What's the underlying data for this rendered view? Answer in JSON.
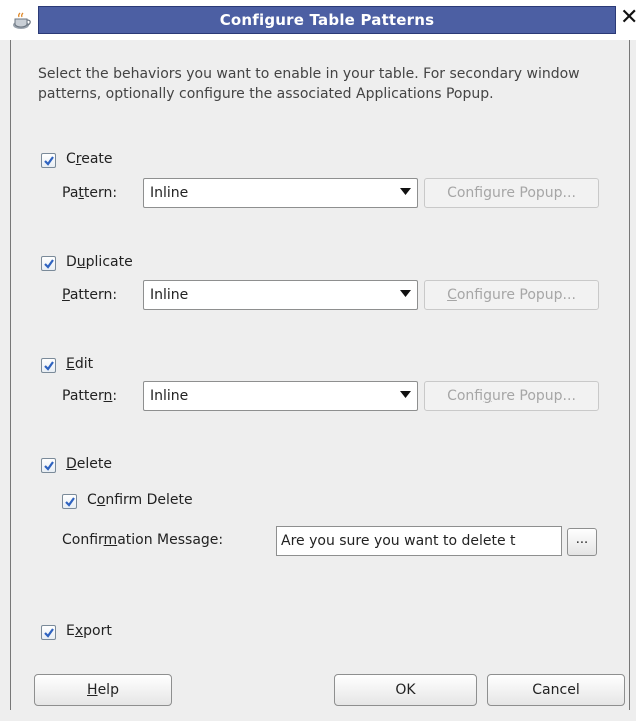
{
  "window": {
    "title": "Configure Table Patterns",
    "icon": "coffee-cup-icon",
    "close_glyph": "✕"
  },
  "intro_text": "Select the behaviors you want to enable in your table.  For secondary window patterns, optionally configure the associated Applications Popup.",
  "sections": {
    "create": {
      "checked": true,
      "label_pre": "C",
      "label_mn": "r",
      "label_post": "eate",
      "pattern_label_pre": "Pa",
      "pattern_label_mn": "t",
      "pattern_label_post": "tern:",
      "pattern_value": "Inline",
      "popup_pre": "Conf",
      "popup_mn": "i",
      "popup_post": "gure Popup..."
    },
    "duplicate": {
      "checked": true,
      "label_pre": "D",
      "label_mn": "u",
      "label_post": "plicate",
      "pattern_label_pre": "",
      "pattern_label_mn": "P",
      "pattern_label_post": "attern:",
      "pattern_value": "Inline",
      "popup_pre": "",
      "popup_mn": "C",
      "popup_post": "onfigure Popup..."
    },
    "edit": {
      "checked": true,
      "label_pre": "",
      "label_mn": "E",
      "label_post": "dit",
      "pattern_label_pre": "Patter",
      "pattern_label_mn": "n",
      "pattern_label_post": ":",
      "pattern_value": "Inline",
      "popup_pre": "Confi",
      "popup_mn": "g",
      "popup_post": "ure Popup..."
    },
    "delete": {
      "checked": true,
      "label_pre": "",
      "label_mn": "D",
      "label_post": "elete",
      "confirm_checked": true,
      "confirm_pre": "C",
      "confirm_mn": "o",
      "confirm_post": "nfirm Delete",
      "message_label_pre": "Confir",
      "message_label_mn": "m",
      "message_label_post": "ation Message:",
      "message_value": "Are you sure you want to delete t",
      "ellipsis": "..."
    },
    "export": {
      "checked": true,
      "label_pre": "E",
      "label_mn": "x",
      "label_post": "port"
    }
  },
  "buttons": {
    "help_pre": "",
    "help_mn": "H",
    "help_post": "elp",
    "ok": "OK",
    "cancel": "Cancel"
  },
  "colors": {
    "title_band": "#4c5fa3",
    "check_mark": "#2f63c0",
    "dialog_bg": "#eeeeee"
  }
}
